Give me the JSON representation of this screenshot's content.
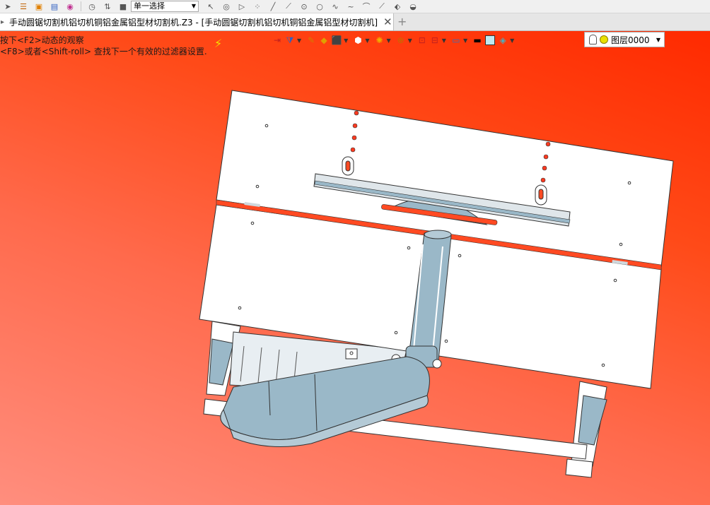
{
  "toolbar": {
    "select_mode_value": "单一选择",
    "icons": [
      "arrow-icon",
      "list-icon",
      "open-icon",
      "save-icon",
      "print-icon",
      "clock-icon",
      "sort-icon",
      "stop-icon",
      "pointer-icon",
      "eye-icon",
      "play-icon",
      "nodes-icon",
      "line-icon",
      "line2-icon",
      "circle-icon",
      "circle2-icon",
      "curve-icon",
      "wave-icon",
      "arc-icon",
      "pin-icon",
      "shape-icon",
      "cup-icon"
    ]
  },
  "tab": {
    "title": "手动圆锯切割机铝切机铜铝金属铝型材切割机.Z3 - [手动圆锯切割机铝切机铜铝金属铝型材切割机]",
    "close_glyph": "✕",
    "add_glyph": "+"
  },
  "viewport": {
    "hint_line1": "按下<F2>动态的观察",
    "hint_line2": "<F8>或者<Shift-roll> 查找下一个有效的过滤器设置.",
    "layer_value": "图层0000"
  },
  "colors": {
    "bg_top": "#ff2a00",
    "bg_bottom": "#ff8e7e",
    "part_blue": "#9ab8c8",
    "part_white": "#ffffff"
  }
}
